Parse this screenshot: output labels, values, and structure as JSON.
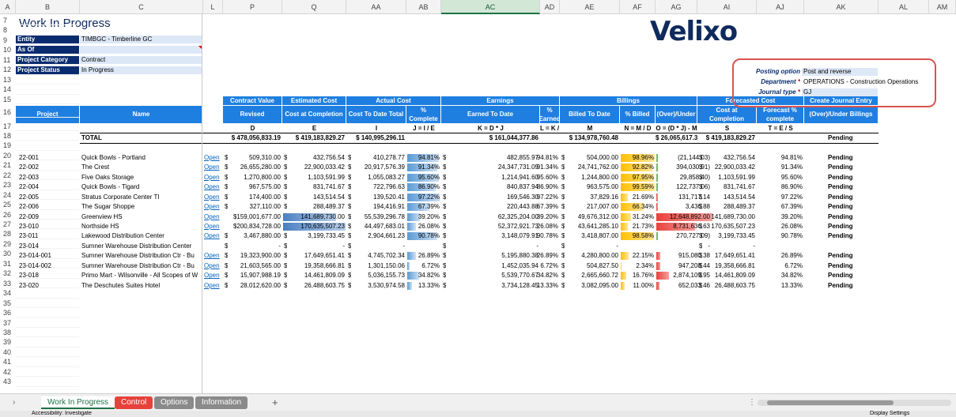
{
  "column_headers": [
    {
      "label": "A"
    },
    {
      "label": "B"
    },
    {
      "label": "C"
    },
    {
      "label": "L"
    },
    {
      "label": "P"
    },
    {
      "label": "Q"
    },
    {
      "label": "AA"
    },
    {
      "label": "AB"
    },
    {
      "label": "AC"
    },
    {
      "label": "AD"
    },
    {
      "label": "AE"
    },
    {
      "label": "AF"
    },
    {
      "label": "AG"
    },
    {
      "label": "AI"
    },
    {
      "label": "AJ"
    },
    {
      "label": "AK"
    },
    {
      "label": "AL"
    },
    {
      "label": "AM"
    }
  ],
  "row_numbers": [
    "7",
    "8",
    "9",
    "10",
    "11",
    "12",
    "13",
    "14",
    "15",
    "16",
    "17",
    "18",
    "19",
    "20",
    "21",
    "22",
    "23",
    "24",
    "25",
    "26",
    "27",
    "28",
    "29",
    "30",
    "31",
    "32",
    "33",
    "34",
    "35",
    "36",
    "37",
    "38",
    "39",
    "40",
    "41",
    "42",
    "43"
  ],
  "title": "Work In Progress",
  "logo": "Velixo",
  "params": {
    "entity_label": "Entity",
    "entity_value": "TIMBGC - Timberline GC",
    "asof_label": "As Of",
    "asof_value": "",
    "category_label": "Project Category",
    "category_value": "Contract",
    "status_label": "Project Status",
    "status_value": "In Progress"
  },
  "posting": {
    "option_label": "Posting option",
    "option_value": "Post and reverse",
    "department_label": "Department",
    "department_value": "OPERATIONS - Construction Operations",
    "journal_label": "Journal type",
    "journal_value": "GJ",
    "required_mark": "*"
  },
  "groups": {
    "contract": "Contract Value",
    "estimated": "Estimated Cost",
    "actual": "Actual Cost",
    "earnings": "Earnings",
    "billings": "Billings",
    "forecasted": "Forecasted Cost",
    "create_je": "Create Journal Entry"
  },
  "headers": {
    "project": "Project",
    "name": "Name",
    "revised": "Revised",
    "cost_at_completion": "Cost at Completion",
    "cost_to_date": "Cost To Date Total",
    "pct_complete": "% Complete",
    "earned_to_date": "Earned To Date",
    "pct_earned": "% Earned",
    "billed_to_date": "Billed To Date",
    "pct_billed": "% Billed",
    "over_under": "(Over)/Under",
    "fc_cost_at_completion": "Cost at Completion",
    "forecast_pct": "Forecast % complete",
    "over_under_billings": "(Over)/Under Billings"
  },
  "formulas": {
    "revised": "D",
    "cost_at_completion": "E",
    "cost_to_date": "I",
    "pct_complete": "J = I / E",
    "earned_to_date": "K = D * J",
    "pct_earned": "L = K / D",
    "billed_to_date": "M",
    "pct_billed": "N = M / D",
    "over_under": "O = (D * J) - M",
    "fc_cost": "S",
    "forecast_pct": "T = E / S"
  },
  "total": {
    "label": "TOTAL",
    "revised": "$ 478,056,833.19",
    "est_cost": "$ 419,183,829.27",
    "cost_to_date": "$ 140,995,296.11",
    "earned": "$ 161,044,377.86",
    "billed": "$ 134,978,760.48",
    "over_under": "$ 26,065,617.39",
    "fc_cost": "$ 419,183,829.27",
    "status": "Pending"
  },
  "open_label": "Open",
  "rows": [
    {
      "project": "22-001",
      "name": "Quick Bowls - Portland",
      "open": true,
      "revised": "509,310.00",
      "est": "432,756.54",
      "ctd": "410,278.77",
      "pct": "94.81%",
      "pctv": 94.81,
      "earned": "482,855.97",
      "pe": "94.81%",
      "billed": "504,000.00",
      "pb": "98.96%",
      "pbv": 98.96,
      "ou": "(21,144.03)",
      "ouv": -21144.03,
      "fc": "432,756.54",
      "fp": "94.81%",
      "status": "Pending"
    },
    {
      "project": "22-002",
      "name": "The Crest",
      "open": true,
      "revised": "26,655,280.00",
      "est": "22,900,033.42",
      "ctd": "20,917,576.39",
      "pct": "91.34%",
      "pctv": 91.34,
      "earned": "24,347,731.09",
      "pe": "91.34%",
      "billed": "24,741,762.00",
      "pb": "92.82%",
      "pbv": 92.82,
      "ou": "394,030.91)",
      "ouv": -394030.91,
      "fc": "22,900,033.42",
      "fp": "91.34%",
      "status": "Pending"
    },
    {
      "project": "22-003",
      "name": "Five Oaks Storage",
      "open": true,
      "revised": "1,270,800.00",
      "est": "1,103,591.99",
      "ctd": "1,055,083.27",
      "pct": "95.60%",
      "pctv": 95.6,
      "earned": "1,214,941.60",
      "pe": "95.60%",
      "billed": "1,244,800.00",
      "pb": "97.95%",
      "pbv": 97.95,
      "ou": "29,858.40)",
      "ouv": -29858.4,
      "fc": "1,103,591.99",
      "fp": "95.60%",
      "status": "Pending"
    },
    {
      "project": "22-004",
      "name": "Quick Bowls - Tigard",
      "open": true,
      "revised": "967,575.00",
      "est": "831,741.67",
      "ctd": "722,796.63",
      "pct": "86.90%",
      "pctv": 86.9,
      "earned": "840,837.94",
      "pe": "86.90%",
      "billed": "963,575.00",
      "pb": "99.59%",
      "pbv": 99.59,
      "ou": "122,737.06)",
      "ouv": -122737.06,
      "fc": "831,741.67",
      "fp": "86.90%",
      "status": "Pending"
    },
    {
      "project": "22-005",
      "name": "Stratus Corporate Center TI",
      "open": true,
      "revised": "174,400.00",
      "est": "143,514.54",
      "ctd": "139,520.41",
      "pct": "97.22%",
      "pctv": 97.22,
      "earned": "169,546.30",
      "pe": "97.22%",
      "billed": "37,829.16",
      "pb": "21.69%",
      "pbv": 21.69,
      "ou": "131,717.14",
      "ouv": 131717.14,
      "fc": "143,514.54",
      "fp": "97.22%",
      "status": "Pending"
    },
    {
      "project": "22-006",
      "name": "The Sugar Shoppe",
      "open": true,
      "revised": "327,110.00",
      "est": "288,489.37",
      "ctd": "194,416.91",
      "pct": "67.39%",
      "pctv": 67.39,
      "earned": "220,443.88",
      "pe": "67.39%",
      "billed": "217,007.00",
      "pb": "66.34%",
      "pbv": 66.34,
      "ou": "3,436.88",
      "ouv": 3436.88,
      "fc": "288,489.37",
      "fp": "67.39%",
      "status": "Pending"
    },
    {
      "project": "22-009",
      "name": "Greenview HS",
      "open": true,
      "revised": "$159,001,677.00",
      "est": "141,689,730.00",
      "ctd": "55,539,296.78",
      "pct": "39.20%",
      "pctv": 39.2,
      "earned": "62,325,204.00",
      "pe": "39.20%",
      "billed": "49,676,312.00",
      "pb": "31.24%",
      "pbv": 31.24,
      "ou": "12,648,892.00",
      "ouv": 12648892.0,
      "fc": "141,689,730.00",
      "fp": "39.20%",
      "status": "Pending",
      "est_hi": 0.85
    },
    {
      "project": "23-010",
      "name": "Northside HS",
      "open": true,
      "revised": "$200,834,728.00",
      "est": "170,635,507.23",
      "ctd": "44,497,683.01",
      "pct": "26.08%",
      "pctv": 26.08,
      "earned": "52,372,921.73",
      "pe": "26.08%",
      "billed": "43,641,285.10",
      "pb": "21.73%",
      "pbv": 21.73,
      "ou": "8,731,636.63",
      "ouv": 8731636.63,
      "fc": "170,635,507.23",
      "fp": "26.08%",
      "status": "Pending",
      "est_hi": 1.0
    },
    {
      "project": "23-011",
      "name": "Lakewood Distribution Center",
      "open": true,
      "revised": "3,467,880.00",
      "est": "3,199,733.45",
      "ctd": "2,904,661.23",
      "pct": "90.78%",
      "pctv": 90.78,
      "earned": "3,148,079.91",
      "pe": "90.78%",
      "billed": "3,418,807.00",
      "pb": "98.58%",
      "pbv": 98.58,
      "ou": "270,727.09)",
      "ouv": -270727.09,
      "fc": "3,199,733.45",
      "fp": "90.78%",
      "status": "Pending"
    },
    {
      "project": "23-014",
      "name": "Sumner Warehouse Distribution Center",
      "open": false,
      "revised": "-",
      "est": "-",
      "ctd": "-",
      "pct": "",
      "pctv": 0,
      "earned": "-",
      "pe": "",
      "billed": "-",
      "pb": "",
      "pbv": 0,
      "ou": "-",
      "ouv": 0,
      "fc": "-",
      "fp": "",
      "status": ""
    },
    {
      "project": "23-014-001",
      "name": "Sumner Warehouse Distribution Ctr - Bu",
      "open": true,
      "revised": "19,323,900.00",
      "est": "17,649,651.41",
      "ctd": "4,745,702.34",
      "pct": "26.89%",
      "pctv": 26.89,
      "earned": "5,195,880.38",
      "pe": "26.89%",
      "billed": "4,280,800.00",
      "pb": "22.15%",
      "pbv": 22.15,
      "ou": "915,080.38",
      "ouv": 915080.38,
      "fc": "17,649,651.41",
      "fp": "26.89%",
      "status": "Pending"
    },
    {
      "project": "23-014-002",
      "name": "Sumner Warehouse Distribution Ctr - Bu",
      "open": true,
      "revised": "21,603,565.00",
      "est": "19,358,666.81",
      "ctd": "1,301,150.06",
      "pct": "6.72%",
      "pctv": 6.72,
      "earned": "1,452,035.94",
      "pe": "6.72%",
      "billed": "504,827.50",
      "pb": "2.34%",
      "pbv": 2.34,
      "ou": "947,208.44",
      "ouv": 947208.44,
      "fc": "19,358,666.81",
      "fp": "6.72%",
      "status": "Pending"
    },
    {
      "project": "23-018",
      "name": "Primo Mart - Wilsonville - All Scopes of W",
      "open": true,
      "revised": "15,907,988.19",
      "est": "14,461,809.09",
      "ctd": "5,036,155.73",
      "pct": "34.82%",
      "pctv": 34.82,
      "earned": "5,539,770.67",
      "pe": "34.82%",
      "billed": "2,665,660.72",
      "pb": "16.76%",
      "pbv": 16.76,
      "ou": "2,874,109.95",
      "ouv": 2874109.95,
      "fc": "14,461,809.09",
      "fp": "34.82%",
      "status": "Pending"
    },
    {
      "project": "23-020",
      "name": "The Deschutes Suites Hotel",
      "open": true,
      "revised": "28,012,620.00",
      "est": "26,488,603.75",
      "ctd": "3,530,974.58",
      "pct": "13.33%",
      "pctv": 13.33,
      "earned": "3,734,128.45",
      "pe": "13.33%",
      "billed": "3,082,095.00",
      "pb": "11.00%",
      "pbv": 11.0,
      "ou": "652,033.46",
      "ouv": 652033.46,
      "fc": "26,488,603.75",
      "fp": "13.33%",
      "status": "Pending"
    }
  ],
  "tabs": {
    "work_in_progress": "Work In Progress",
    "control": "Control",
    "options": "Options",
    "information": "Information",
    "add": "+"
  },
  "status_bar": {
    "accessibility": "Accessibility: Investigate",
    "display_settings": "Display Settings"
  },
  "colors": {
    "header_blue": "#1f7fe0",
    "label_navy": "#0a2c6f",
    "value_bg": "#dde8f7",
    "bar_blue": "#5b9bd5",
    "bar_orange": "#ffc000",
    "bar_red": "#e8413b",
    "tab_red": "#e8413b",
    "tab_grey": "#8a8a8a"
  }
}
